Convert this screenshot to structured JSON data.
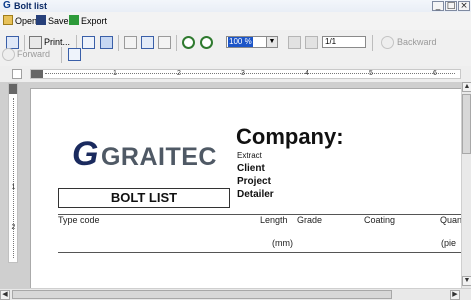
{
  "window": {
    "title": "Bolt list"
  },
  "menu": {
    "open": "Open",
    "save": "Save",
    "export": "Export"
  },
  "toolbar": {
    "print": "Print...",
    "zoom": "100 %",
    "page": "1/1",
    "backward": "Backward",
    "forward": "Forward"
  },
  "ruler_numbers": [
    "1",
    "2",
    "3",
    "4",
    "5",
    "6"
  ],
  "vruler_numbers": [
    "1",
    "2"
  ],
  "report": {
    "logo_text": "GRAITEC",
    "company_label": "Company:",
    "extract_label": "Extract",
    "client_label": "Client",
    "project_label": "Project",
    "detailer_label": "Detailer",
    "title": "BOLT LIST",
    "columns": {
      "type_code": "Type code",
      "length": "Length",
      "grade": "Grade",
      "coating": "Coating",
      "quantity": "Quan"
    },
    "units": {
      "length": "(mm)",
      "quantity": "(pie"
    }
  }
}
